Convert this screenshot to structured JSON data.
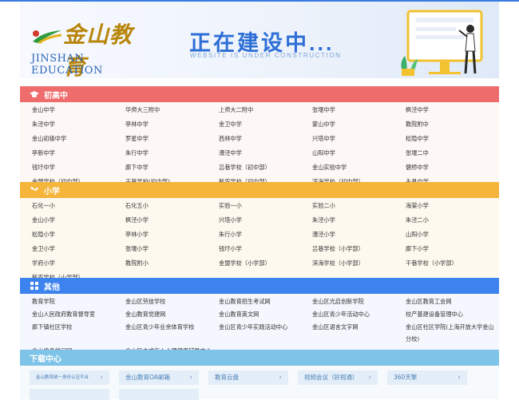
{
  "banner": {
    "logo_cn": "金山教育",
    "logo_en": "JINSHAN EDUCATION",
    "headline": "正在建设中...",
    "subline": "WEBSITE IS UNDER CONSTRUCTION"
  },
  "sections": [
    {
      "title": "初高中",
      "color": "#ef6c6c",
      "icon": "graduation-cap-icon",
      "links": [
        "金山中学",
        "华师大三附中",
        "上师大二附中",
        "张堰中学",
        "枫泾中学",
        "朱泾中学",
        "亭林中学",
        "金卫中学",
        "蒙山中学",
        "教院附中",
        "金山初级中学",
        "罗星中学",
        "西林中学",
        "兴塔中学",
        "松隐中学",
        "亭新中学",
        "朱行中学",
        "漕泾中学",
        "山阳中学",
        "张堰二中",
        "钱圩中学",
        "廊下中学",
        "吕巷学校（初中部）",
        "金山实验中学",
        "健桥中学",
        "金盟学校（初中部）",
        "干巷学校(初中部)",
        "新农学校（初中部）",
        "滨海学校（初中部）",
        "永昌中学"
      ]
    },
    {
      "title": "小学",
      "color": "#f5b43a",
      "icon": "sprout-icon",
      "links": [
        "石化一小",
        "石化五小",
        "实验一小",
        "实验二小",
        "海棠小学",
        "金山小学",
        "枫泾小学",
        "兴塔小学",
        "朱泾小学",
        "朱泾二小",
        "松隐小学",
        "亭林小学",
        "朱行小学",
        "漕泾小学",
        "山阳小学",
        "金卫小学",
        "张堰小学",
        "钱圩小学",
        "吕巷学校（小学部）",
        "廊下小学",
        "学府小学",
        "教院附小",
        "金盟学校（小学部）",
        "滨海学校（小学部）",
        "干巷学校（小学部）",
        "新农学校（小学部）"
      ]
    },
    {
      "title": "其他",
      "color": "#3d83ef",
      "icon": "grid-icon",
      "links": [
        "教育学院",
        "金山区劳技学校",
        "金山教育招生考试网",
        "金山区光启创新学院",
        "金山区教育工会网",
        "金山人民政府教育督导室",
        "金山教育党建网",
        "金山教育英文网",
        "金山区青少年活动中心",
        "校产基建设备管理中心",
        "廊下镇社区学校",
        "金山区青少年业余体育学校",
        "金山区青少年实践活动中心",
        "金山区语言文字网",
        "金山区社区学院(上海开放大学金山分校)",
        "金山终身学习网",
        "金山区未成年人心理健康辅导中心"
      ]
    },
    {
      "title": "下载中心",
      "color": "#7ec3e8",
      "icon": "download-icon",
      "downloads": [
        "金山教育统一身份认证平台",
        "金山教育OA邮箱",
        "教育云盘",
        "视频会议（好视通）",
        "360天擎"
      ]
    }
  ]
}
